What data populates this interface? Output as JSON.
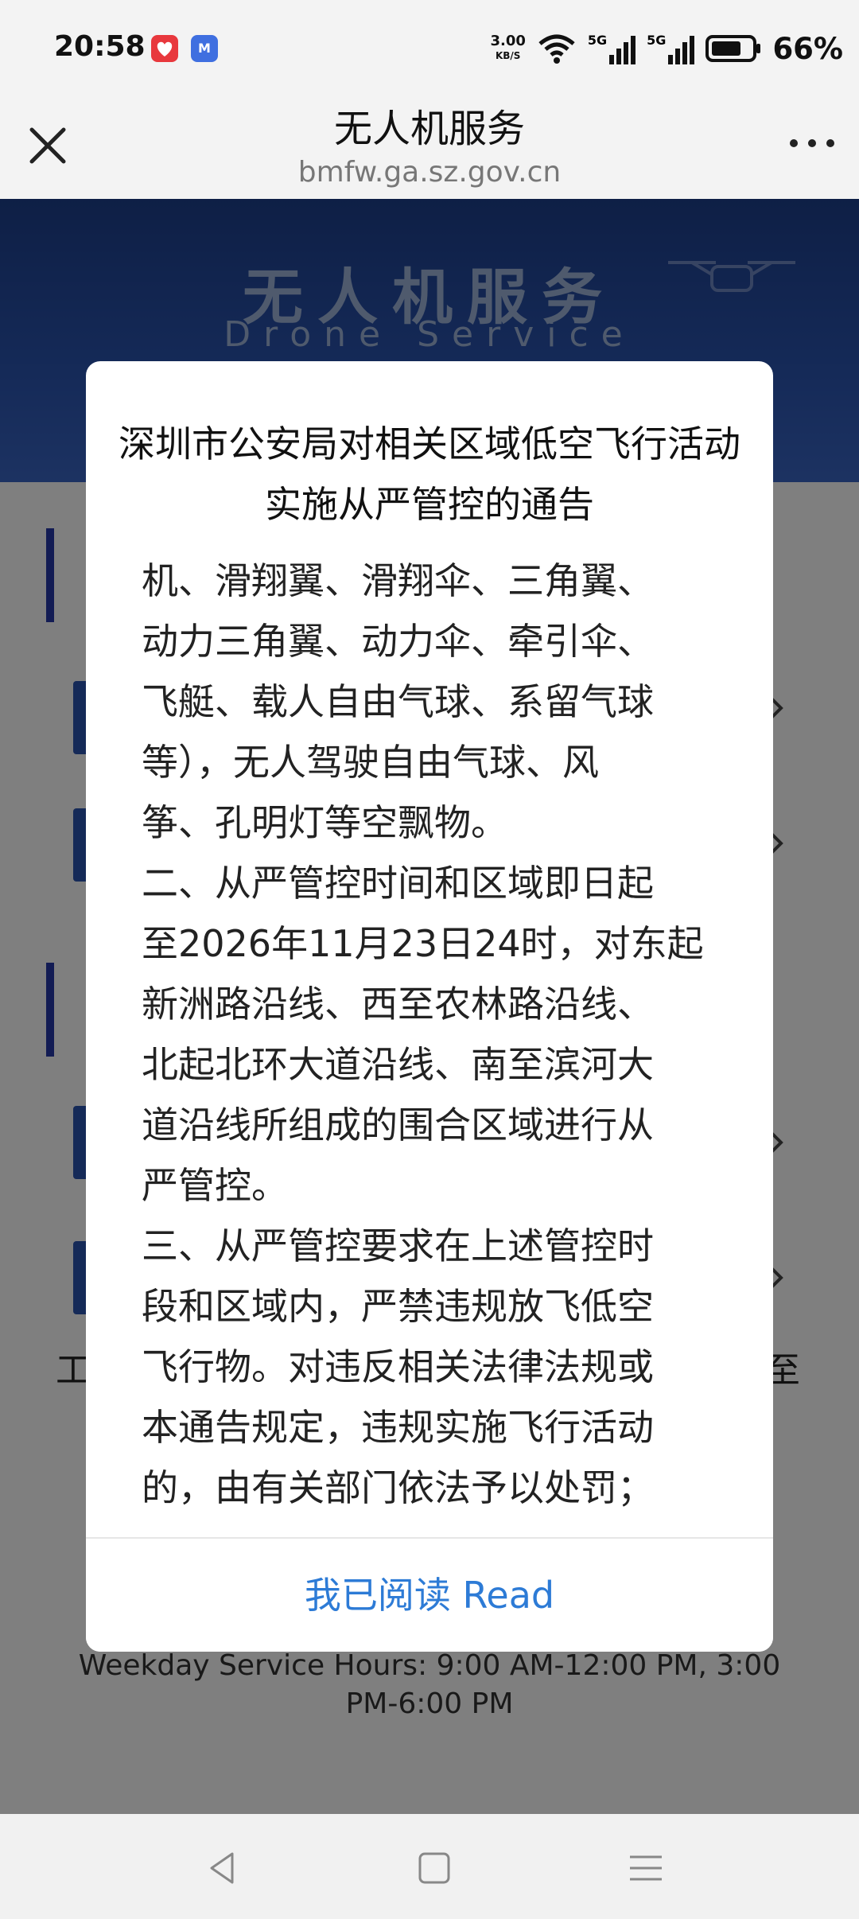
{
  "status_bar": {
    "time": "20:58",
    "app_icon_2_label": "M",
    "net_speed_value": "3.00",
    "net_speed_unit": "KB/S",
    "signal_1": "5G",
    "signal_2": "5G",
    "battery": "66%"
  },
  "titlebar": {
    "title": "无人机服务",
    "url": "bmfw.ga.sz.gov.cn",
    "icons": [
      "close-icon",
      "more-icon"
    ]
  },
  "banner": {
    "title": "无人机服务",
    "subtitle": "Drone Service"
  },
  "background": {
    "partial_left": "工",
    "partial_right": "至",
    "service_hours": "Weekday Service Hours: 9:00 AM-12:00 PM, 3:00\nPM-6:00 PM"
  },
  "modal": {
    "title": "深圳市公安局对相关区域低空飞行活动\n实施从严管控的通告",
    "body": "机、滑翔翼、滑翔伞、三角翼、\n动力三角翼、动力伞、牵引伞、\n飞艇、载人自由气球、系留气球\n等），无人驾驶自由气球、风\n筝、孔明灯等空飘物。\n二、从严管控时间和区域即日起\n至2026年11月23日24时，对东起\n新洲路沿线、西至农林路沿线、\n北起北环大道沿线、南至滨河大\n道沿线所组成的围合区域进行从\n严管控。\n三、从严管控要求在上述管控时\n段和区域内，严禁违规放飞低空\n飞行物。对违反相关法律法规或\n本通告规定，违规实施飞行活动\n的，由有关部门依法予以处罚；",
    "read_button": "我已阅读 Read"
  },
  "colors": {
    "accent": "#2d7bd6",
    "banner": "#2a54b0",
    "section_bar": "#2638a8"
  }
}
